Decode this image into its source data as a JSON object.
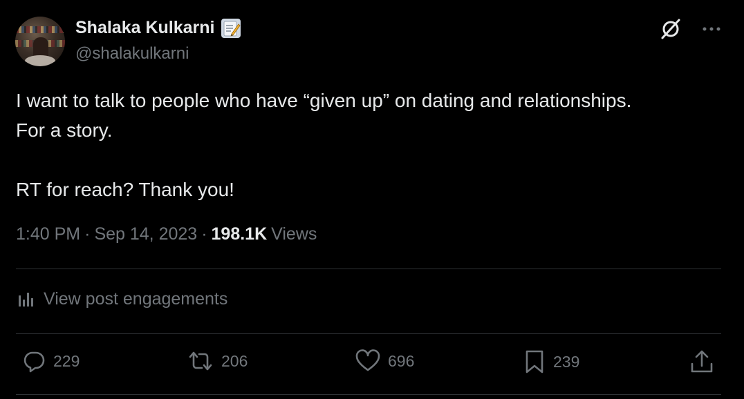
{
  "author": {
    "name": "Shalaka Kulkarni",
    "handle": "@shalakulkarni",
    "badge_icon": "memo-icon"
  },
  "header_icons": [
    "grok-icon",
    "more-icon"
  ],
  "tweet": {
    "lines": [
      "I want to talk to people who have “given up” on dating and relationships.",
      "For a story.",
      "",
      "RT for reach? Thank you!"
    ]
  },
  "meta": {
    "time": "1:40 PM",
    "separator": "·",
    "date": "Sep 14, 2023",
    "views_count": "198.1K",
    "views_label": "Views"
  },
  "engagements": {
    "label": "View post engagements"
  },
  "actions": {
    "replies": "229",
    "reposts": "206",
    "likes": "696",
    "bookmarks": "239"
  },
  "colors": {
    "background": "#000000",
    "text": "#e7e9ea",
    "secondary": "#71767b",
    "divider": "#2f3336"
  }
}
